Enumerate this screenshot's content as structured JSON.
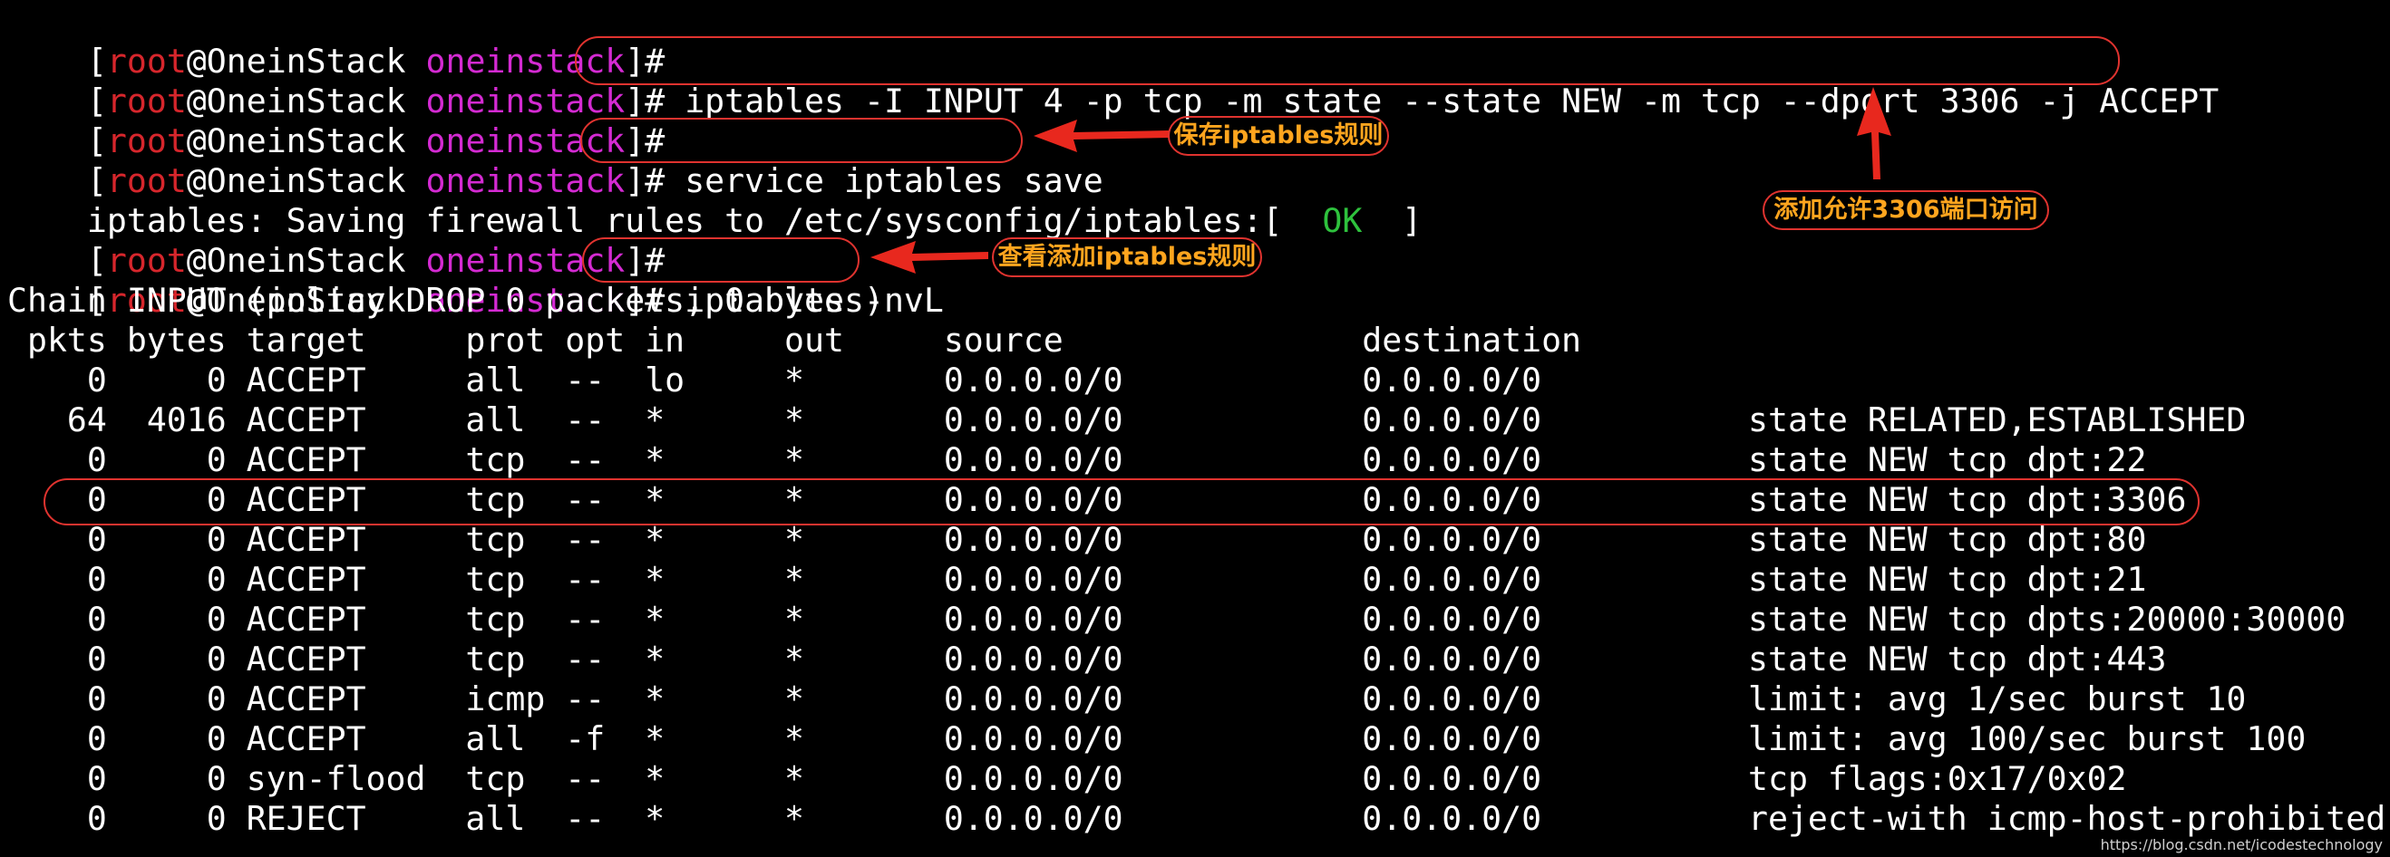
{
  "prompt": {
    "open_bracket": "[",
    "user": "root",
    "at": "@",
    "host": "OneinStack",
    "space": " ",
    "dir": "oneinstack",
    "close": "]#"
  },
  "commands": {
    "insert_rule": " iptables -I INPUT 4 -p tcp -m state --state NEW -m tcp --dport 3306 -j ACCEPT",
    "save": " service iptables save",
    "list": " iptables -nvL"
  },
  "save_output": {
    "prefix": "iptables: Saving firewall rules to /etc/sysconfig/iptables:[  ",
    "ok": "OK",
    "suffix": "  ]"
  },
  "chain_header": "Chain INPUT (policy DROP 0 packets, 0 bytes)",
  "table": {
    "header": " pkts bytes target     prot opt in     out     source               destination",
    "rows": [
      {
        "text": "    0     0 ACCEPT     all  --  lo     *       0.0.0.0/0            0.0.0.0/0",
        "extra": ""
      },
      {
        "text": "   64  4016 ACCEPT     all  --  *      *       0.0.0.0/0            0.0.0.0/0",
        "extra": "state RELATED,ESTABLISHED"
      },
      {
        "text": "    0     0 ACCEPT     tcp  --  *      *       0.0.0.0/0            0.0.0.0/0",
        "extra": "state NEW tcp dpt:22"
      },
      {
        "text": "    0     0 ACCEPT     tcp  --  *      *       0.0.0.0/0            0.0.0.0/0",
        "extra": "state NEW tcp dpt:3306"
      },
      {
        "text": "    0     0 ACCEPT     tcp  --  *      *       0.0.0.0/0            0.0.0.0/0",
        "extra": "state NEW tcp dpt:80"
      },
      {
        "text": "    0     0 ACCEPT     tcp  --  *      *       0.0.0.0/0            0.0.0.0/0",
        "extra": "state NEW tcp dpt:21"
      },
      {
        "text": "    0     0 ACCEPT     tcp  --  *      *       0.0.0.0/0            0.0.0.0/0",
        "extra": "state NEW tcp dpts:20000:30000"
      },
      {
        "text": "    0     0 ACCEPT     tcp  --  *      *       0.0.0.0/0            0.0.0.0/0",
        "extra": "state NEW tcp dpt:443"
      },
      {
        "text": "    0     0 ACCEPT     icmp --  *      *       0.0.0.0/0            0.0.0.0/0",
        "extra": "limit: avg 1/sec burst 10"
      },
      {
        "text": "    0     0 ACCEPT     all  -f  *      *       0.0.0.0/0            0.0.0.0/0",
        "extra": "limit: avg 100/sec burst 100"
      },
      {
        "text": "    0     0 syn-flood  tcp  --  *      *       0.0.0.0/0            0.0.0.0/0",
        "extra": "tcp flags:0x17/0x02"
      },
      {
        "text": "    0     0 REJECT     all  --  *      *       0.0.0.0/0            0.0.0.0/0",
        "extra": "reject-with icmp-host-prohibited"
      }
    ]
  },
  "annotations": {
    "save_rules": "保存iptables规则",
    "allow_3306": "添加允许3306端口访问",
    "view_rules": "查看添加iptables规则"
  },
  "watermark": "https://blog.csdn.net/icodestechnology",
  "colors": {
    "background": "#000000",
    "prompt_user": "#d7262c",
    "prompt_dir": "#d42ad2",
    "ok_status": "#2ec23d",
    "annotation_outline": "#e0332f",
    "annotation_text": "#ffa51e"
  }
}
